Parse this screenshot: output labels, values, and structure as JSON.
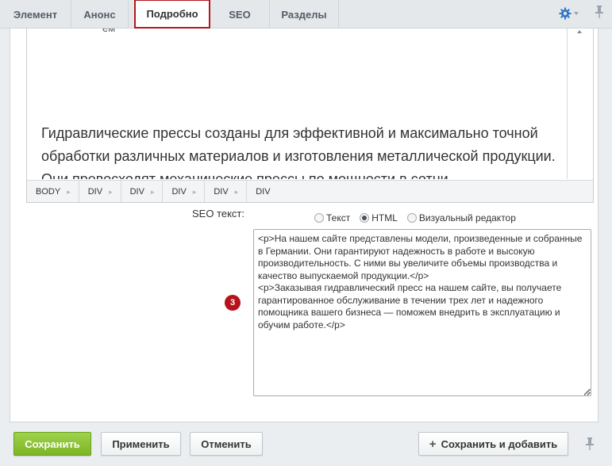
{
  "tabs": [
    {
      "label": "Элемент",
      "active": false
    },
    {
      "label": "Анонс",
      "active": false
    },
    {
      "label": "Подробно",
      "active": true
    },
    {
      "label": "SEO",
      "active": false
    },
    {
      "label": "Разделы",
      "active": false
    }
  ],
  "toolbar_icons": {
    "settings": "gear-icon",
    "pin": "pin-icon"
  },
  "editor": {
    "cut_top_text": "ем",
    "paragraph": "Гидравлические прессы созданы для эффективной и максимально точной обработки различных материалов и изготовления металлической продукции. Они превосходят механические прессы по мощности в сотни",
    "breadcrumbs": [
      "BODY",
      "DIV",
      "DIV",
      "DIV",
      "DIV",
      "DIV"
    ]
  },
  "seo": {
    "label": "SEO текст:",
    "modes": [
      {
        "label": "Текст",
        "selected": false
      },
      {
        "label": "HTML",
        "selected": true
      },
      {
        "label": "Визуальный редактор",
        "selected": false
      }
    ],
    "badge": "3",
    "content": "<p>На нашем сайте представлены модели, произведенные и собранные в Германии. Они гарантируют надежность в работе и высокую производительность. С ними вы увеличите объемы производства и качество выпускаемой продукции.</p>\n<p>Заказывая гидравлический пресс на нашем сайте, вы получаете гарантированное обслуживание в течении трех лет и надежного помощника вашего бизнеса — поможем внедрить в эксплуатацию и обучим работе.</p>"
  },
  "buttons": {
    "save": "Сохранить",
    "apply": "Применить",
    "cancel": "Отменить",
    "save_add": "Сохранить и добавить"
  },
  "colors": {
    "active_tab_border": "#b1191c",
    "save_button": "#8cc63f",
    "badge": "#b5121b",
    "gear": "#2e77c9"
  }
}
